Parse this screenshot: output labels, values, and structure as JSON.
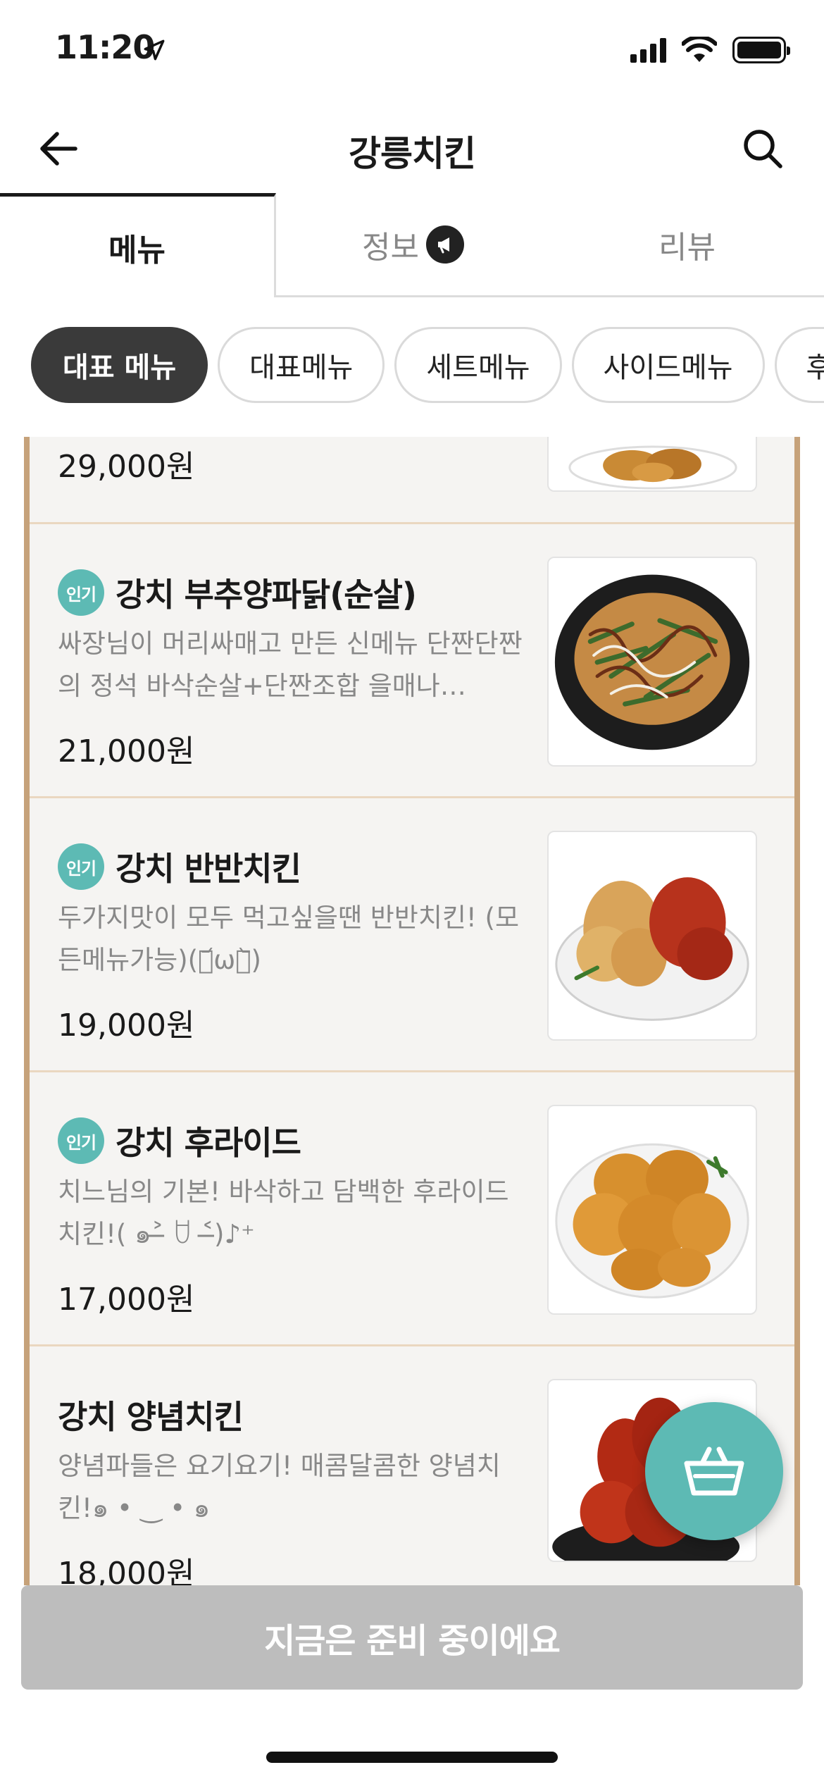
{
  "status_bar": {
    "time": "11:20"
  },
  "header": {
    "title": "강릉치킨"
  },
  "tabs": [
    {
      "label": "메뉴",
      "active": true
    },
    {
      "label": "정보",
      "active": false
    },
    {
      "label": "리뷰",
      "active": false
    }
  ],
  "chips": [
    {
      "label": "대표 메뉴",
      "active": true
    },
    {
      "label": "대표메뉴",
      "active": false
    },
    {
      "label": "세트메뉴",
      "active": false
    },
    {
      "label": "사이드메뉴",
      "active": false
    },
    {
      "label": "후라",
      "active": false
    }
  ],
  "menu_items": [
    {
      "name": "",
      "popular": false,
      "description": "",
      "price": "29,000원"
    },
    {
      "name": "강치 부추양파닭(순살)",
      "popular": true,
      "badge": "인기",
      "description": "싸장님이 머리싸매고 만든 신메뉴 단짠단짠의 정석 바삭순살+단짠조합 을매나…",
      "price": "21,000원"
    },
    {
      "name": "강치 반반치킨",
      "popular": true,
      "badge": "인기",
      "description": "두가지맛이 모두 먹고싶을땐 반반치킨! (모든메뉴가능)(･᷄ω･᷅)",
      "price": "19,000원"
    },
    {
      "name": "강치 후라이드",
      "popular": true,
      "badge": "인기",
      "description": "치느님의 기본! 바삭하고 담백한 후라이드 치킨!( ๑˃̶ ꇴ ˂̶)♪⁺",
      "price": "17,000원"
    },
    {
      "name": "강치 양념치킨",
      "popular": false,
      "description": "양념파들은 요기요기! 매콤달콤한 양념치킨!๑ • ‿ • ๑",
      "price": "18,000원"
    }
  ],
  "bottom_button": {
    "label": "지금은 준비 중이에요"
  },
  "colors": {
    "accent": "#5dbab4",
    "frame": "#c6a27a",
    "disabled": "#bdbdbd"
  }
}
